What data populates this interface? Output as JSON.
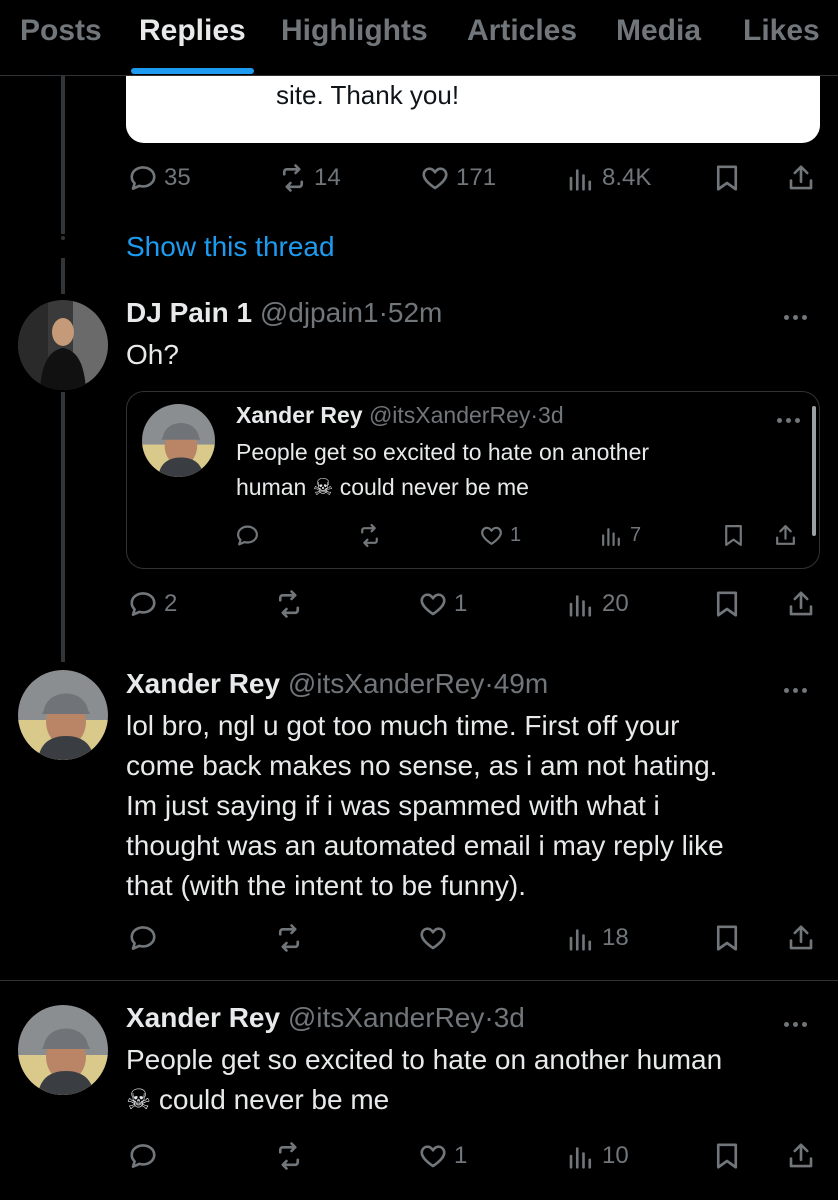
{
  "tabs": [
    "Posts",
    "Replies",
    "Highlights",
    "Articles",
    "Media",
    "Likes"
  ],
  "card": {
    "text": "site. Thank you!"
  },
  "thread_actions": {
    "replies": "35",
    "reposts": "14",
    "likes": "171",
    "views": "8.4K"
  },
  "show_thread": "Show this thread",
  "reply1": {
    "name": "DJ Pain 1",
    "handle": "@djpain1",
    "time": "52m",
    "text": "Oh?",
    "actions": {
      "replies": "2",
      "reposts": "",
      "likes": "1",
      "views": "20"
    }
  },
  "quote": {
    "name": "Xander Rey",
    "handle": "@itsXanderRey",
    "time": "3d",
    "line1": "People get so excited to hate on another",
    "line2_a": "human",
    "line2_b": "could never be me",
    "emoji": "☠",
    "actions": {
      "replies": "",
      "reposts": "",
      "likes": "1",
      "views": "7"
    }
  },
  "reply2": {
    "name": "Xander Rey",
    "handle": "@itsXanderRey",
    "time": "49m",
    "lines": [
      "lol bro, ngl u got too much time. First off your",
      "come back makes no sense, as i am not hating.",
      "Im just saying if i was spammed with what i",
      "thought was an automated email i may reply like",
      "that (with the intent to be funny)."
    ],
    "actions": {
      "replies": "",
      "reposts": "",
      "likes": "",
      "views": "18"
    }
  },
  "tweet3": {
    "name": "Xander Rey",
    "handle": "@itsXanderRey",
    "time": "3d",
    "line1": "People get so excited to hate on another human",
    "line2": "could never be me",
    "emoji": "☠",
    "actions": {
      "replies": "",
      "reposts": "",
      "likes": "1",
      "views": "10"
    }
  },
  "separator": "·",
  "icons": {
    "reply": "reply-icon",
    "repost": "repost-icon",
    "like": "like-icon",
    "views": "views-icon",
    "bookmark": "bookmark-icon",
    "share": "share-icon",
    "more": "more-icon"
  },
  "colors": {
    "background": "#000000",
    "text": "#e7e9ea",
    "muted": "#71767b",
    "accent": "#1d9bf0",
    "border": "#2f3336"
  }
}
